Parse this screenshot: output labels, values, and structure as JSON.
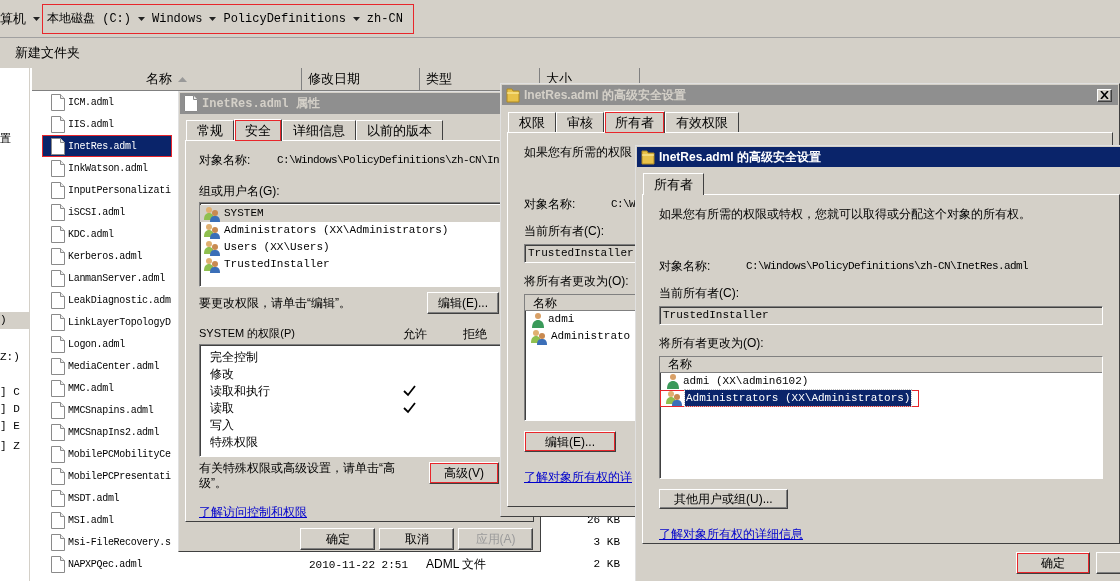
{
  "explorer": {
    "breadcrumb": {
      "prefix": "算机",
      "highlighted": true,
      "items": [
        "本地磁盘 (C:)",
        "Windows",
        "PolicyDefinitions",
        "zh-CN"
      ]
    },
    "toolbar": [
      "新建文件夹"
    ],
    "nav_items": [
      {
        "label": "置",
        "selected": false
      },
      {
        "label": ")",
        "selected": true
      },
      {
        "label": "Z:)",
        "selected": false
      },
      {
        "label": "] C",
        "selected": false
      },
      {
        "label": "] D",
        "selected": false
      },
      {
        "label": "] E",
        "selected": false
      },
      {
        "label": "] Z",
        "selected": false
      }
    ],
    "columns": [
      "名称",
      "修改日期",
      "类型",
      "大小"
    ],
    "files": [
      {
        "name": "ICM.adml",
        "selected": false,
        "highlighted": false
      },
      {
        "name": "IIS.adml",
        "selected": false,
        "highlighted": false
      },
      {
        "name": "InetRes.adml",
        "selected": true,
        "highlighted": true
      },
      {
        "name": "InkWatson.adml",
        "selected": false,
        "highlighted": false
      },
      {
        "name": "InputPersonalizati",
        "selected": false,
        "highlighted": false
      },
      {
        "name": "iSCSI.adml",
        "selected": false,
        "highlighted": false
      },
      {
        "name": "KDC.adml",
        "selected": false,
        "highlighted": false
      },
      {
        "name": "Kerberos.adml",
        "selected": false,
        "highlighted": false
      },
      {
        "name": "LanmanServer.adml",
        "selected": false,
        "highlighted": false
      },
      {
        "name": "LeakDiagnostic.adm",
        "selected": false,
        "highlighted": false
      },
      {
        "name": "LinkLayerTopologyD",
        "selected": false,
        "highlighted": false
      },
      {
        "name": "Logon.adml",
        "selected": false,
        "highlighted": false
      },
      {
        "name": "MediaCenter.adml",
        "selected": false,
        "highlighted": false
      },
      {
        "name": "MMC.adml",
        "selected": false,
        "highlighted": false
      },
      {
        "name": "MMCSnapins.adml",
        "selected": false,
        "highlighted": false
      },
      {
        "name": "MMCSnapIns2.adml",
        "selected": false,
        "highlighted": false
      },
      {
        "name": "MobilePCMobilityCe",
        "selected": false,
        "highlighted": false
      },
      {
        "name": "MobilePCPresentati",
        "selected": false,
        "highlighted": false
      },
      {
        "name": "MSDT.adml",
        "selected": false,
        "highlighted": false
      },
      {
        "name": "MSI.adml",
        "size": "26 KB",
        "selected": false,
        "highlighted": false
      },
      {
        "name": "Msi-FileRecovery.s",
        "size": "3 KB",
        "selected": false,
        "highlighted": false
      },
      {
        "name": "NAPXPQec.adml",
        "date": "2010-11-22 2:51",
        "type": "ADML 文件",
        "size": "2 KB",
        "selected": false,
        "highlighted": false
      }
    ]
  },
  "properties_dialog": {
    "active": false,
    "title": "InetRes.adml 属性",
    "tabs": [
      {
        "label": "常规",
        "selected": false,
        "highlighted": false
      },
      {
        "label": "安全",
        "selected": true,
        "highlighted": true
      },
      {
        "label": "详细信息",
        "selected": false,
        "highlighted": false
      },
      {
        "label": "以前的版本",
        "selected": false,
        "highlighted": false
      }
    ],
    "object_label": "对象名称:",
    "object_path": "C:\\Windows\\PolicyDefinitions\\zh-CN\\In",
    "groups_label": "组或用户名(G):",
    "groups": [
      {
        "name": "SYSTEM",
        "selected": true
      },
      {
        "name": "Administrators (XX\\Administrators)",
        "selected": false
      },
      {
        "name": "Users (XX\\Users)",
        "selected": false
      },
      {
        "name": "TrustedInstaller",
        "selected": false
      }
    ],
    "edit_hint": "要更改权限，请单击“编辑”。",
    "edit_button": {
      "label": "编辑(E)...",
      "highlighted": false
    },
    "permissions_label": "SYSTEM 的权限(P)",
    "allow_label": "允许",
    "deny_label": "拒绝",
    "permissions": [
      {
        "name": "完全控制",
        "allow": false,
        "deny": false
      },
      {
        "name": "修改",
        "allow": false,
        "deny": false
      },
      {
        "name": "读取和执行",
        "allow": true,
        "deny": false
      },
      {
        "name": "读取",
        "allow": true,
        "deny": false
      },
      {
        "name": "写入",
        "allow": false,
        "deny": false
      },
      {
        "name": "特殊权限",
        "allow": false,
        "deny": false
      }
    ],
    "advanced_hint": "有关特殊权限或高级设置，请单击“高级”。",
    "advanced_button": {
      "label": "高级(V)",
      "highlighted": true
    },
    "link": "了解访问控制和权限",
    "buttons": [
      {
        "label": "确定",
        "disabled": false
      },
      {
        "label": "取消",
        "disabled": false
      },
      {
        "label": "应用(A)",
        "disabled": true
      }
    ]
  },
  "advanced_dialog": {
    "active": false,
    "title": "InetRes.adml 的高级安全设置",
    "close_button": true,
    "tabs": [
      {
        "label": "权限",
        "selected": false,
        "highlighted": false
      },
      {
        "label": "审核",
        "selected": false,
        "highlighted": false
      },
      {
        "label": "所有者",
        "selected": true,
        "highlighted": true
      },
      {
        "label": "有效权限",
        "selected": false,
        "highlighted": false
      }
    ],
    "intro": "如果您有所需的权限",
    "object_label": "对象名称:",
    "object_path": "C:\\W",
    "owner_label": "当前所有者(C):",
    "owner": "TrustedInstaller",
    "change_label": "将所有者更改为(O):",
    "list_header": "名称",
    "candidates": [
      {
        "name": "admi",
        "kind": "user",
        "selected": false,
        "highlighted": false
      },
      {
        "name": "Administrato",
        "kind": "group",
        "selected": false,
        "highlighted": false
      }
    ],
    "action_button": {
      "label": "编辑(E)...",
      "highlighted": true
    },
    "link": "了解对象所有权的详"
  },
  "owner_dialog": {
    "active": true,
    "title": "InetRes.adml 的高级安全设置",
    "tabs": [
      {
        "label": "所有者",
        "selected": true,
        "highlighted": false
      }
    ],
    "intro": "如果您有所需的权限或特权，您就可以取得或分配这个对象的所有权。",
    "object_label": "对象名称:",
    "object_path": "C:\\Windows\\PolicyDefinitions\\zh-CN\\InetRes.adml",
    "owner_label": "当前所有者(C):",
    "owner": "TrustedInstaller",
    "change_label": "将所有者更改为(O):",
    "list_header": "名称",
    "candidates": [
      {
        "name": "admi (XX\\admin6102)",
        "kind": "user",
        "selected": false,
        "highlighted": false
      },
      {
        "name": "Administrators (XX\\Administrators)",
        "kind": "group",
        "selected": true,
        "highlighted": true
      }
    ],
    "action_button": {
      "label": "其他用户或组(U)...",
      "highlighted": false
    },
    "link": "了解对象所有权的详细信息",
    "buttons": [
      {
        "label": "确定",
        "highlighted": true
      },
      {
        "highlighted": false
      }
    ]
  }
}
